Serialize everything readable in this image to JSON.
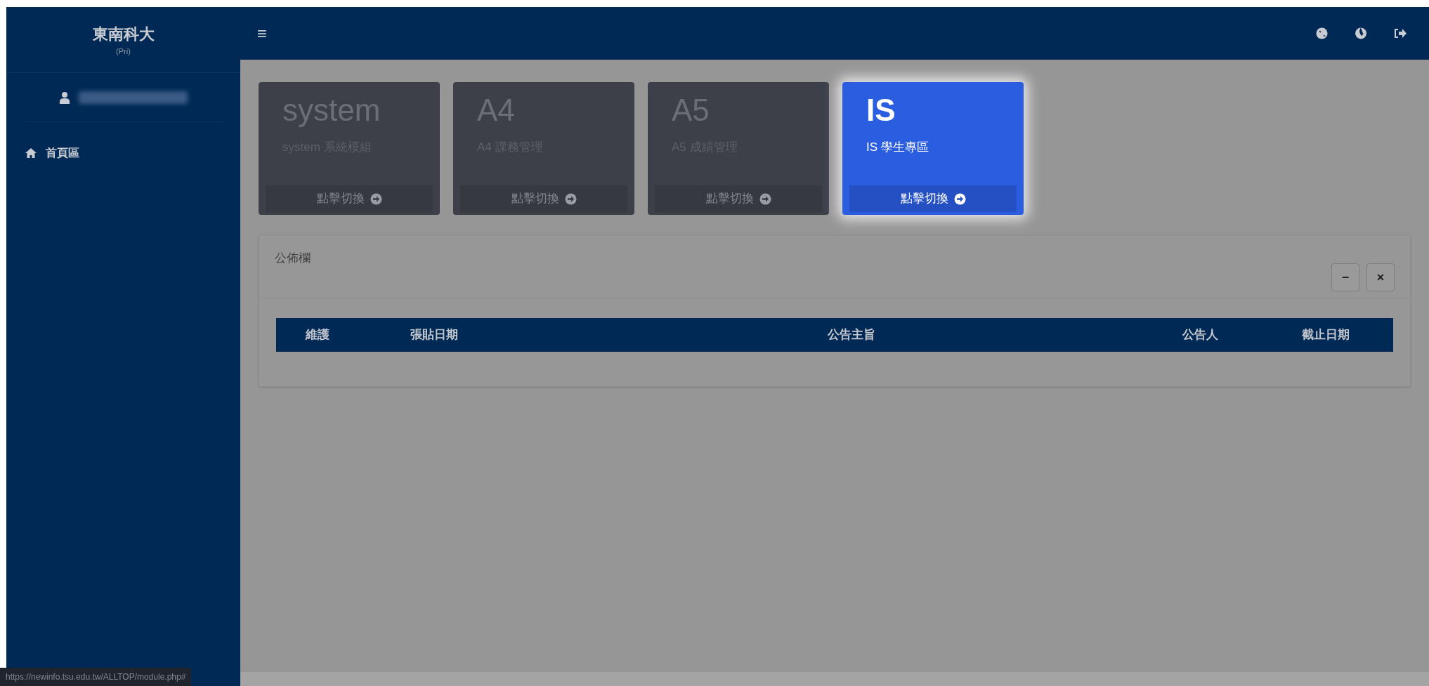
{
  "brand": {
    "title": "東南科大",
    "subtitle": "(Pri)"
  },
  "sidebar": {
    "items": [
      {
        "label": "首頁區"
      }
    ]
  },
  "header": {
    "menu_glyph": "≡"
  },
  "modules": [
    {
      "title": "system",
      "subtitle": "system 系統模組",
      "action": "點擊切換",
      "selected": false
    },
    {
      "title": "A4",
      "subtitle": "A4 課務管理",
      "action": "點擊切換",
      "selected": false
    },
    {
      "title": "A5",
      "subtitle": "A5 成績管理",
      "action": "點擊切換",
      "selected": false
    },
    {
      "title": "IS",
      "subtitle": "IS 學生專區",
      "action": "點擊切換",
      "selected": true
    }
  ],
  "panel": {
    "title": "公佈欄",
    "buttons": [
      "−",
      "×"
    ],
    "table": {
      "columns": [
        "維護",
        "張貼日期",
        "公告主旨",
        "公告人",
        "截止日期"
      ]
    }
  },
  "status_bar": "https://newinfo.tsu.edu.tw/ALLTOP/module.php#"
}
